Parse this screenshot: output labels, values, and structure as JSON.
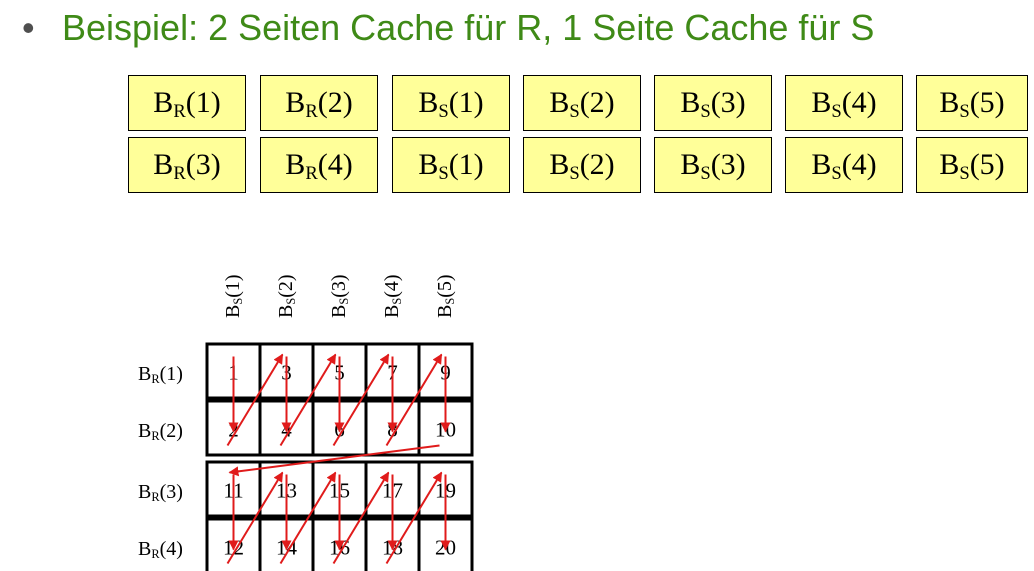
{
  "heading": {
    "bullet": "•",
    "text": "Beispiel: 2 Seiten Cache für R, 1 Seite Cache für S"
  },
  "cache_rows": [
    [
      {
        "base": "B",
        "sub": "R",
        "idx": "(1)"
      },
      {
        "base": "B",
        "sub": "R",
        "idx": "(2)"
      },
      {
        "base": "B",
        "sub": "S",
        "idx": "(1)"
      },
      {
        "base": "B",
        "sub": "S",
        "idx": "(2)"
      },
      {
        "base": "B",
        "sub": "S",
        "idx": "(3)"
      },
      {
        "base": "B",
        "sub": "S",
        "idx": "(4)"
      },
      {
        "base": "B",
        "sub": "S",
        "idx": "(5)"
      }
    ],
    [
      {
        "base": "B",
        "sub": "R",
        "idx": "(3)"
      },
      {
        "base": "B",
        "sub": "R",
        "idx": "(4)"
      },
      {
        "base": "B",
        "sub": "S",
        "idx": "(1)"
      },
      {
        "base": "B",
        "sub": "S",
        "idx": "(2)"
      },
      {
        "base": "B",
        "sub": "S",
        "idx": "(3)"
      },
      {
        "base": "B",
        "sub": "S",
        "idx": "(4)"
      },
      {
        "base": "B",
        "sub": "S",
        "idx": "(5)"
      }
    ]
  ],
  "grid": {
    "col_labels": [
      {
        "base": "B",
        "sub": "S",
        "idx": "(1)"
      },
      {
        "base": "B",
        "sub": "S",
        "idx": "(2)"
      },
      {
        "base": "B",
        "sub": "S",
        "idx": "(3)"
      },
      {
        "base": "B",
        "sub": "S",
        "idx": "(4)"
      },
      {
        "base": "B",
        "sub": "S",
        "idx": "(5)"
      }
    ],
    "row_labels": [
      {
        "base": "B",
        "sub": "R",
        "idx": "(1)"
      },
      {
        "base": "B",
        "sub": "R",
        "idx": "(2)"
      },
      {
        "base": "B",
        "sub": "R",
        "idx": "(3)"
      },
      {
        "base": "B",
        "sub": "R",
        "idx": "(4)"
      }
    ],
    "cells": [
      [
        "1",
        "3",
        "5",
        "7",
        "9"
      ],
      [
        "2",
        "4",
        "6",
        "8",
        "10"
      ],
      [
        "11",
        "13",
        "15",
        "17",
        "19"
      ],
      [
        "12",
        "14",
        "16",
        "18",
        "20"
      ]
    ]
  },
  "colors": {
    "heading": "#3f8a17",
    "cache_fill": "#ffff99",
    "arrow": "#e01b1b",
    "border": "#000000"
  }
}
